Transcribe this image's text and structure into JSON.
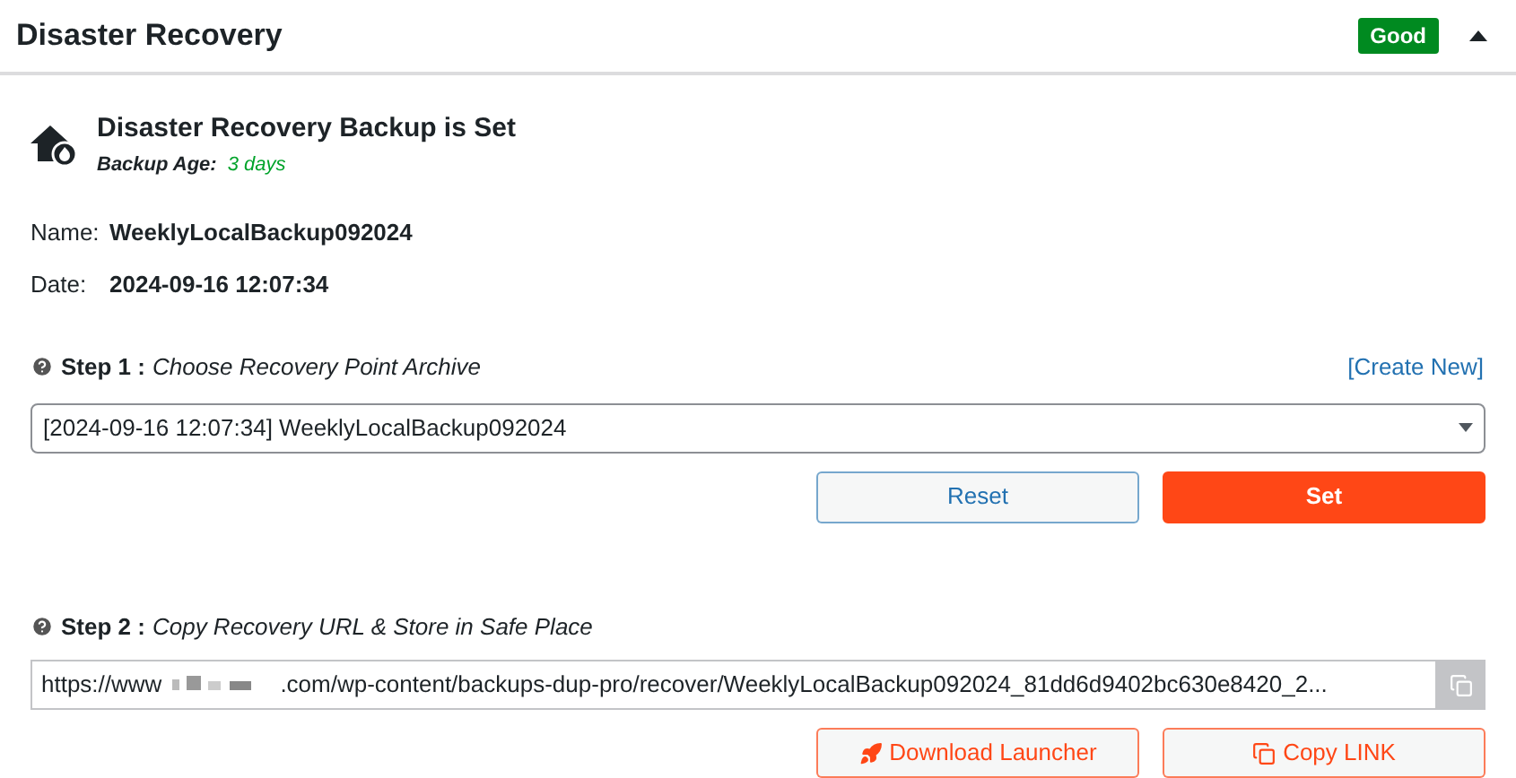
{
  "header": {
    "title": "Disaster Recovery",
    "status_badge": "Good",
    "expanded": true
  },
  "status": {
    "title": "Disaster Recovery Backup is Set",
    "age_label": "Backup Age:",
    "age_value": "3 days"
  },
  "details": [
    {
      "label": "Name:",
      "value": "WeeklyLocalBackup092024"
    },
    {
      "label": "Date:",
      "value": "2024-09-16 12:07:34"
    }
  ],
  "step1": {
    "label": "Step 1 :",
    "description": "Choose Recovery Point Archive",
    "link": "[Create New]",
    "select_value": "[2024-09-16 12:07:34] WeeklyLocalBackup092024",
    "buttons": [
      {
        "label": "Reset",
        "kind": "secondary"
      },
      {
        "label": "Set",
        "kind": "primary"
      }
    ]
  },
  "step2": {
    "label": "Step 2 :",
    "description": "Copy Recovery URL & Store in Safe Place",
    "url_prefix": "https://www",
    "url_suffix": ".com/wp-content/backups-dup-pro/recover/WeeklyLocalBackup092024_81dd6d9402bc630e8420_2...",
    "buttons": [
      {
        "label": "Download Launcher",
        "kind": "rocket"
      },
      {
        "label": "Copy LINK",
        "kind": "copy"
      }
    ]
  }
}
